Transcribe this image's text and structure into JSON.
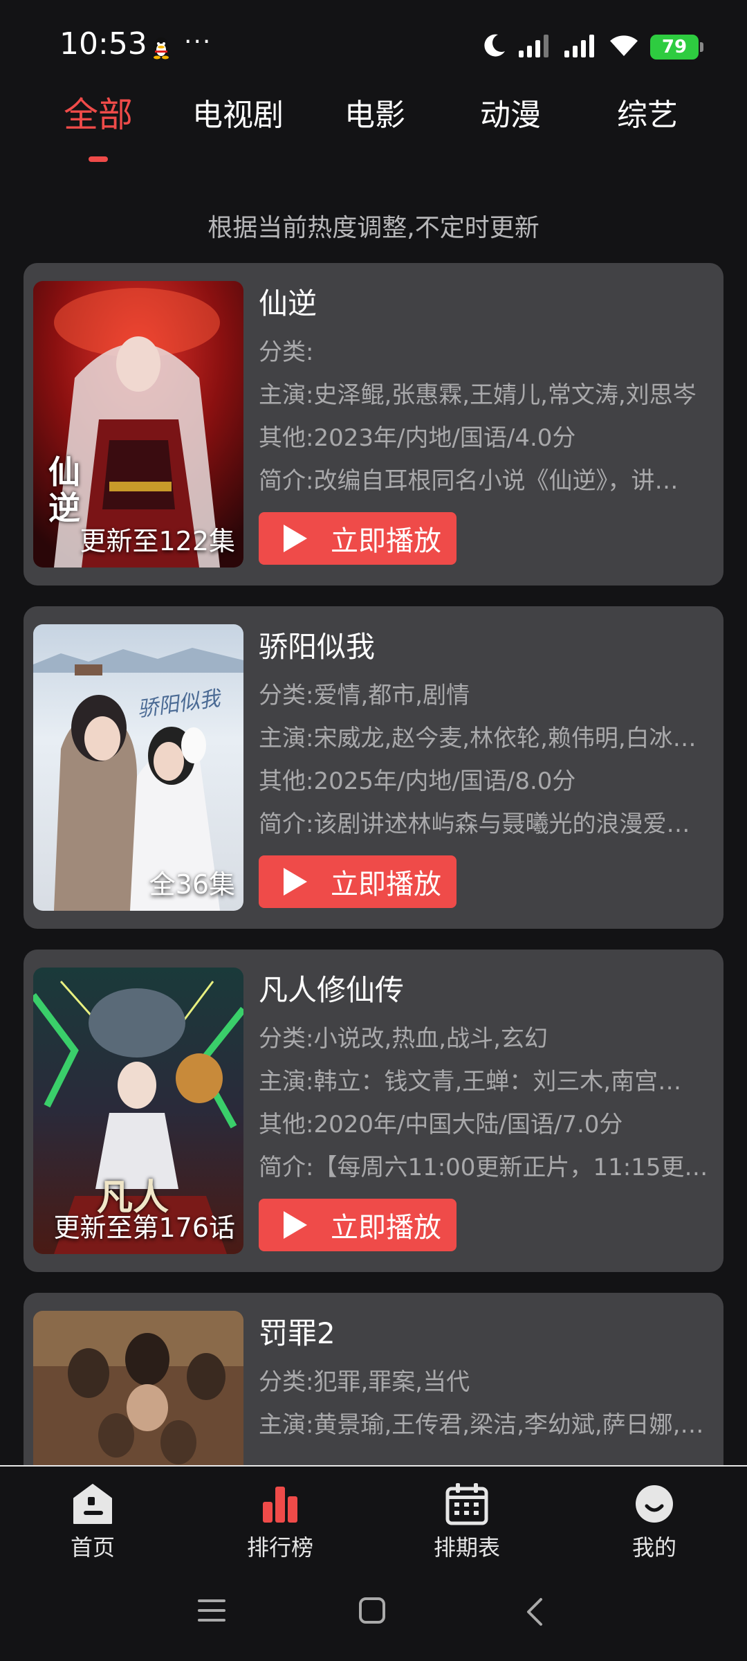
{
  "status_bar": {
    "time": "10:53",
    "dots": "···",
    "battery": "79",
    "icons": [
      "qq-penguin-icon",
      "moon-icon",
      "signal-icon",
      "signal-icon",
      "wifi-icon",
      "battery-icon"
    ]
  },
  "tabs": [
    {
      "label": "全部",
      "active": true
    },
    {
      "label": "电视剧",
      "active": false
    },
    {
      "label": "电影",
      "active": false
    },
    {
      "label": "动漫",
      "active": false
    },
    {
      "label": "综艺",
      "active": false
    }
  ],
  "notice": "根据当前热度调整,不定时更新",
  "play_label": "立即播放",
  "items": [
    {
      "title": "仙逆",
      "category": "分类:",
      "cast": "主演:史泽鲲,张惠霖,王婧儿,常文涛,刘思岑",
      "other": "其他:2023年/内地/国语/4.0分",
      "intro": "简介:改编自耳根同名小说《仙逆》，讲…",
      "badge": "更新至122集",
      "poster_logo": "仙逆"
    },
    {
      "title": "骄阳似我",
      "category": "分类:爱情,都市,剧情",
      "cast": "主演:宋威龙,赵今麦,林依轮,赖伟明,白冰…",
      "other": "其他:2025年/内地/国语/8.0分",
      "intro": "简介:该剧讲述林屿森与聂曦光的浪漫爱…",
      "badge": "全36集",
      "poster_logo": "骄阳似我"
    },
    {
      "title": "凡人修仙传",
      "category": "分类:小说改,热血,战斗,玄幻",
      "cast": "主演:韩立：钱文青,王蝉：刘三木,南宫…",
      "other": "其他:2020年/中国大陆/国语/7.0分",
      "intro": "简介:【每周六11:00更新正片，11:15更新…",
      "badge": "更新至第176话",
      "poster_logo": "凡人"
    },
    {
      "title": "罚罪2",
      "category": "分类:犯罪,罪案,当代",
      "cast": "主演:黄景瑜,王传君,梁洁,李幼斌,萨日娜,…",
      "other": "",
      "intro": "",
      "badge": "",
      "poster_logo": ""
    }
  ],
  "bottom_nav": [
    {
      "label": "首页",
      "icon": "home-icon",
      "active": false
    },
    {
      "label": "排行榜",
      "icon": "bar-chart-icon",
      "active": true
    },
    {
      "label": "排期表",
      "icon": "calendar-icon",
      "active": false
    },
    {
      "label": "我的",
      "icon": "profile-icon",
      "active": false
    }
  ],
  "colors": {
    "accent": "#ef4b49",
    "card": "#424245",
    "background": "#131315",
    "battery": "#2ecc40"
  }
}
